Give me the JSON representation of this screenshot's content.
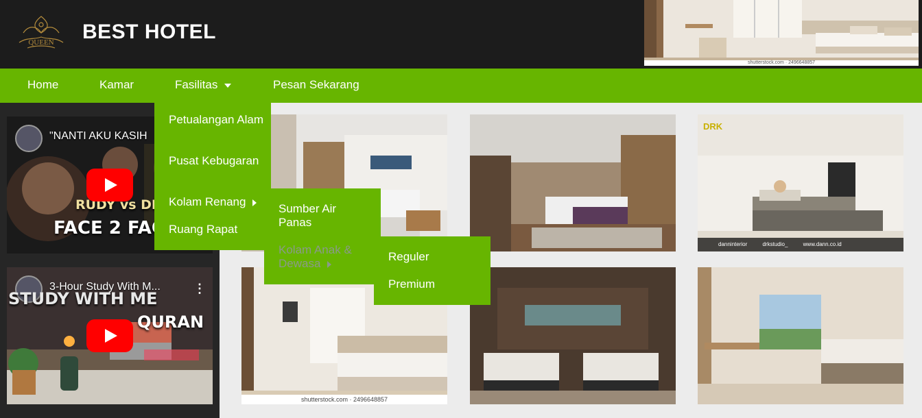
{
  "header": {
    "logo_text": "QUEEN",
    "brand": "BEST HOTEL",
    "hero_caption": "shutterstock.com · 2496648857"
  },
  "nav": {
    "items": [
      {
        "label": "Home"
      },
      {
        "label": "Kamar"
      },
      {
        "label": "Fasilitas"
      },
      {
        "label": "Pesan Sekarang"
      }
    ]
  },
  "dropdown_fasilitas": {
    "items": [
      {
        "label": "Petualangan Alam"
      },
      {
        "label": "Pusat Kebugaran"
      },
      {
        "label": "Kolam Renang"
      },
      {
        "label": "Ruang Rapat"
      }
    ]
  },
  "dropdown_kolam": {
    "items": [
      {
        "label": "Sumber Air Panas"
      },
      {
        "label": "Kolam Anak & Dewasa"
      }
    ]
  },
  "dropdown_anak": {
    "items": [
      {
        "label": "Reguler"
      },
      {
        "label": "Premium"
      }
    ]
  },
  "videos": [
    {
      "title": "\"NANTI AKU KASIH",
      "overlay_top": "RUDY vs DEAN",
      "overlay_bottom": "FACE 2 FAC"
    },
    {
      "title": "3-Hour Study With M...",
      "overlay_top": "STUDY WITH ME",
      "overlay_bottom": "QURAN"
    }
  ],
  "gallery": {
    "watermark": "shutterstock.com · 2496648857",
    "drk_logo": "DRK",
    "drk_footer": [
      "danninterior",
      "drkstudio_",
      "www.dann.co.id"
    ]
  },
  "colors": {
    "accent": "#67b500",
    "header_bg": "#1c1c1c",
    "sidebar_bg": "#262626",
    "page_bg": "#ececec"
  }
}
